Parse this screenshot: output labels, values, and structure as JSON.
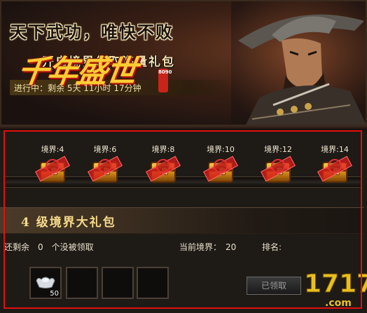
{
  "banner": {
    "slogan": "天下武功，唯快不败",
    "sub_slogan": "开启境界领取海量礼包",
    "logo": "千年盛世",
    "badge": "8090",
    "countdown": "进行中：剩余 5天 11小时 17分钟"
  },
  "tiers": [
    {
      "label": "境界:4"
    },
    {
      "label": "境界:6"
    },
    {
      "label": "境界:8"
    },
    {
      "label": "境界:10"
    },
    {
      "label": "境界:12"
    },
    {
      "label": "境界:14"
    }
  ],
  "gift": {
    "title": "4 级境界大礼包"
  },
  "info": {
    "remaining": "还剩余　0　个没被领取",
    "current_level": "当前境界：　20",
    "rank_label": "排名:"
  },
  "rewards": [
    {
      "icon": "silver-ingot-icon",
      "count": "50"
    },
    {
      "icon": "empty-slot",
      "count": ""
    },
    {
      "icon": "empty-slot",
      "count": ""
    },
    {
      "icon": "empty-slot",
      "count": ""
    }
  ],
  "claim_button": "已领取",
  "watermark": "1717.com",
  "colors": {
    "highlight_outline": "#e01010",
    "gold_text": "#f6d98c",
    "panel_bg": "#1e1a16"
  }
}
